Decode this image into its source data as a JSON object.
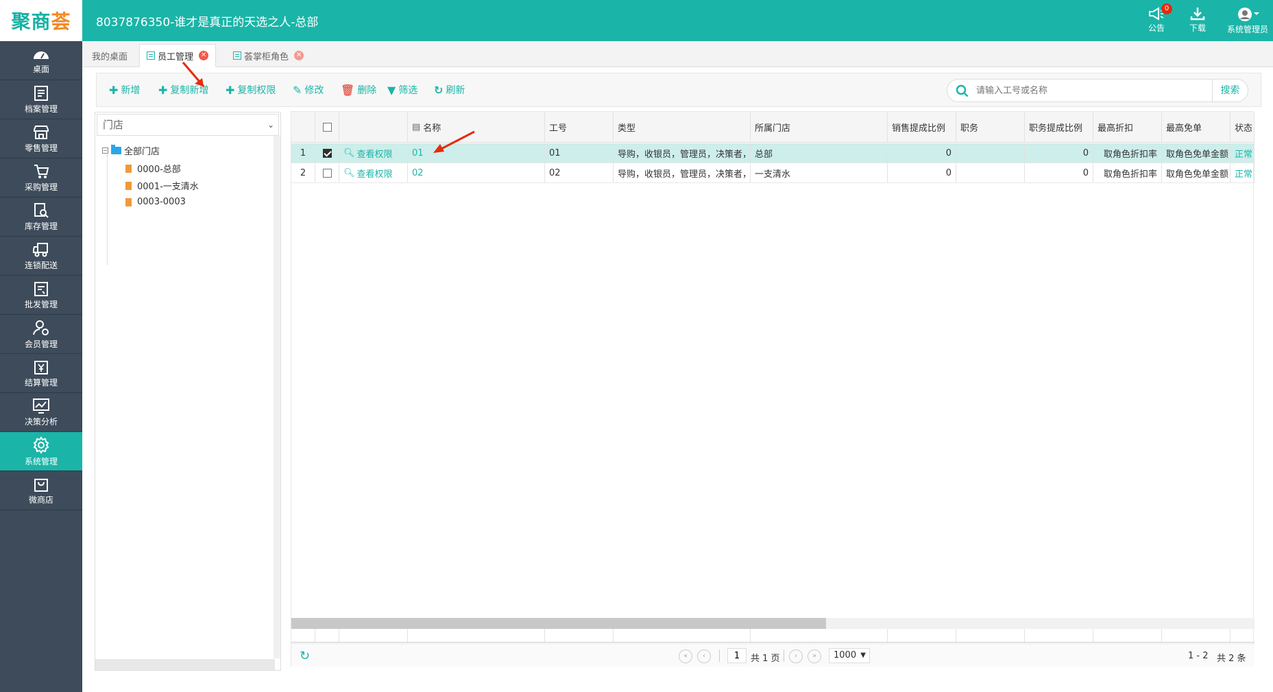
{
  "app": {
    "logo_main": "聚商",
    "logo_accent": "荟",
    "title": "8037876350-谁才是真正的天选之人-总部"
  },
  "top_tools": {
    "notice_label": "公告",
    "notice_badge": "0",
    "download_label": "下载",
    "user_label": "系统管理员"
  },
  "sidebar": {
    "items": [
      {
        "label": "桌面",
        "icon": "dashboard-icon"
      },
      {
        "label": "档案管理",
        "icon": "archive-icon"
      },
      {
        "label": "零售管理",
        "icon": "store-icon"
      },
      {
        "label": "采购管理",
        "icon": "cart-icon"
      },
      {
        "label": "库存管理",
        "icon": "inventory-icon"
      },
      {
        "label": "连锁配送",
        "icon": "truck-icon"
      },
      {
        "label": "批发管理",
        "icon": "wholesale-icon"
      },
      {
        "label": "会员管理",
        "icon": "member-icon"
      },
      {
        "label": "结算管理",
        "icon": "settlement-icon"
      },
      {
        "label": "决策分析",
        "icon": "chart-icon"
      },
      {
        "label": "系统管理",
        "icon": "gear-icon"
      },
      {
        "label": "微商店",
        "icon": "bag-icon"
      }
    ],
    "active_index": 10
  },
  "tabs": [
    {
      "label": "我的桌面"
    },
    {
      "label": "员工管理"
    },
    {
      "label": "荟掌柜角色"
    }
  ],
  "toolbar": {
    "add": "新增",
    "copy_add": "复制新增",
    "copy_perm": "复制权限",
    "edit": "修改",
    "delete": "删除",
    "filter": "筛选",
    "refresh": "刷新"
  },
  "search": {
    "placeholder": "请输入工号或名称",
    "button": "搜索"
  },
  "tree": {
    "select_value": "门店",
    "root": "全部门店",
    "children": [
      "0000-总部",
      "0001-一支清水",
      "0003-0003"
    ]
  },
  "grid": {
    "columns": {
      "name": "名称",
      "code": "工号",
      "type": "类型",
      "store": "所属门店",
      "sales_commission": "销售提成比例",
      "position": "职务",
      "position_commission": "职务提成比例",
      "max_discount": "最高折扣",
      "max_free": "最高免单",
      "status": "状态"
    },
    "rows": [
      {
        "index": "1",
        "checked": true,
        "action": "查看权限",
        "name": "01",
        "code": "01",
        "type": "导购，收银员，管理员，决策者，",
        "store": "总部",
        "sales_commission": "0",
        "position": "",
        "position_commission": "0",
        "max_discount": "取角色折扣率",
        "max_free": "取角色免单金额",
        "status": "正常"
      },
      {
        "index": "2",
        "checked": false,
        "action": "查看权限",
        "name": "02",
        "code": "02",
        "type": "导购，收银员，管理员，决策者，",
        "store": "一支清水",
        "sales_commission": "0",
        "position": "",
        "position_commission": "0",
        "max_discount": "取角色折扣率",
        "max_free": "取角色免单金额",
        "status": "正常"
      }
    ]
  },
  "pager": {
    "page": "1",
    "total_pages": "共 1 页",
    "page_size": "1000",
    "range": "1 - 2",
    "total": "共 2 条"
  },
  "colors": {
    "brand": "#1ab5a8",
    "sidebar_bg": "#3d4b5a",
    "selected_row": "#cdeeea"
  }
}
